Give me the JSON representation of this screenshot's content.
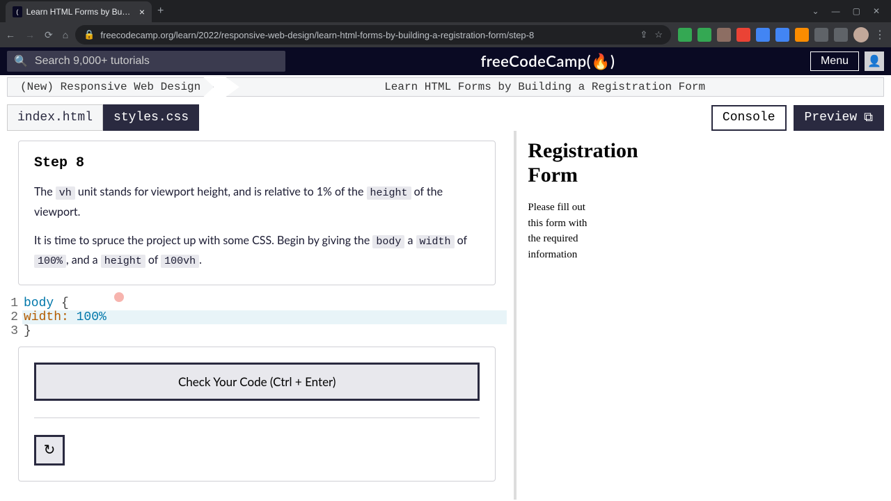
{
  "browser": {
    "tab_title": "Learn HTML Forms by Building a",
    "url": "freecodecamp.org/learn/2022/responsive-web-design/learn-html-forms-by-building-a-registration-form/step-8"
  },
  "fcc_header": {
    "search_placeholder": "Search 9,000+ tutorials",
    "logo_text": "freeCodeCamp(🔥)",
    "menu_label": "Menu"
  },
  "breadcrumb": {
    "course": "(New) Responsive Web Design",
    "lesson": "Learn HTML Forms by Building a Registration Form"
  },
  "tabs": {
    "file_inactive": "index.html",
    "file_active": "styles.css",
    "console": "Console",
    "preview": "Preview"
  },
  "step": {
    "title": "Step 8",
    "p1_a": "The ",
    "p1_code1": "vh",
    "p1_b": " unit stands for viewport height, and is relative to 1% of the ",
    "p1_code2": "height",
    "p1_c": " of the viewport.",
    "p2_a": "It is time to spruce the project up with some CSS. Begin by giving the ",
    "p2_code1": "body",
    "p2_b": " a ",
    "p2_code2": "width",
    "p2_c": " of ",
    "p2_code3": "100%",
    "p2_d": ", and a ",
    "p2_code4": "height",
    "p2_e": " of ",
    "p2_code5": "100vh",
    "p2_f": "."
  },
  "code": {
    "line1_sel": "body",
    "line1_brace": " {",
    "line2_indent": "  ",
    "line2_prop": "width:",
    "line2_val": " 100%",
    "line3": "}",
    "ln1": "1",
    "ln2": "2",
    "ln3": "3"
  },
  "actions": {
    "check": "Check Your Code (Ctrl + Enter)",
    "reset": "↻"
  },
  "preview": {
    "heading": "Registration Form",
    "paragraph": "Please fill out this form with the required information"
  }
}
